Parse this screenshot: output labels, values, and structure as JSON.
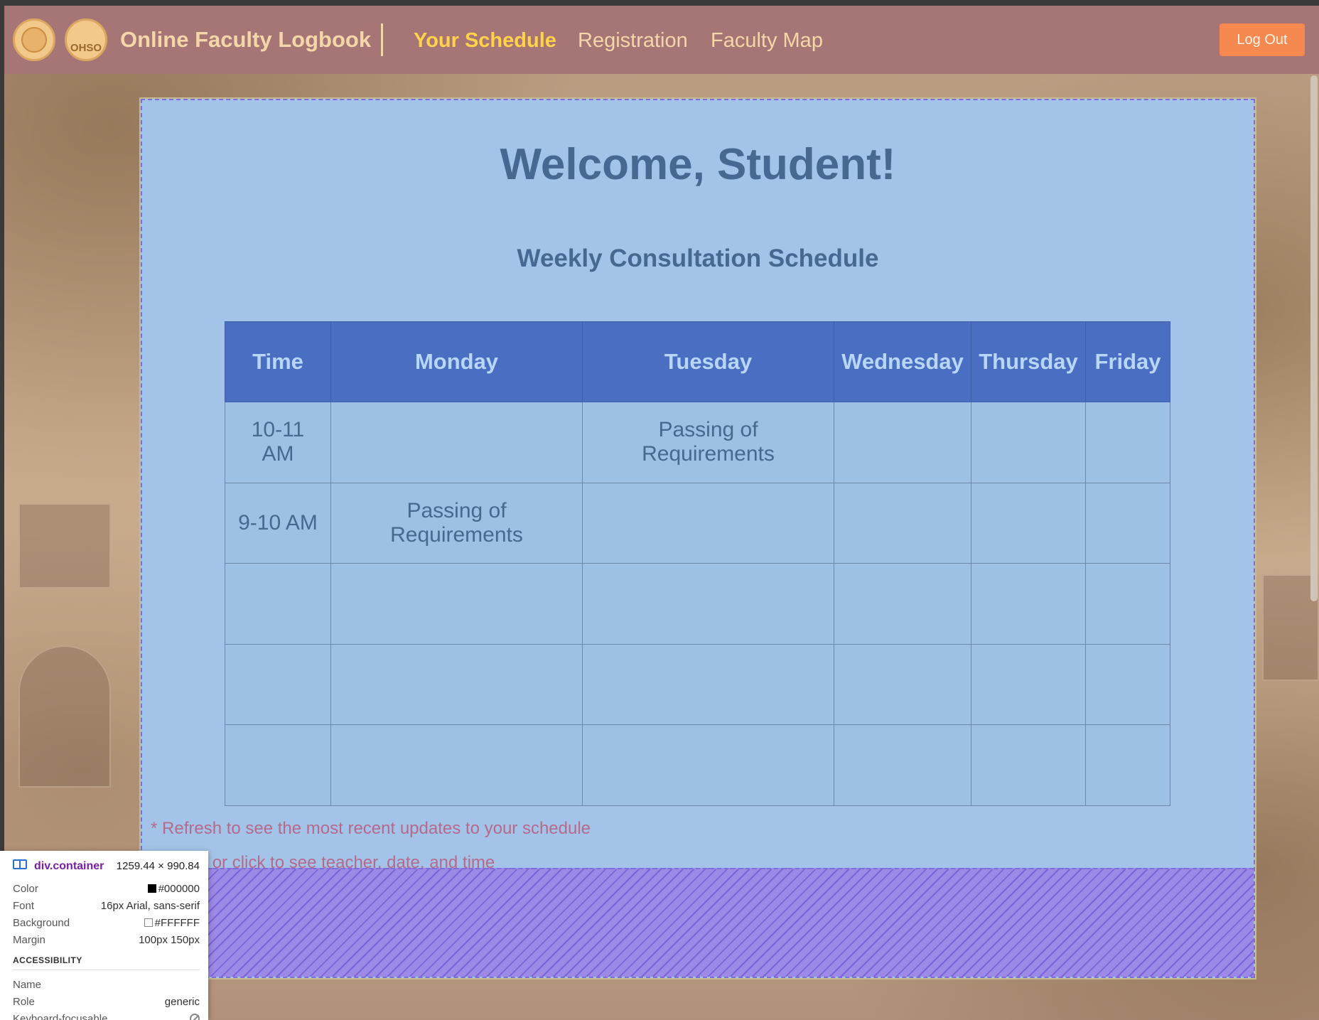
{
  "navbar": {
    "brand": "Online Faculty Logbook",
    "logo2_text": "OHSO",
    "links": [
      "Your Schedule",
      "Registration",
      "Faculty Map"
    ],
    "logout": "Log Out"
  },
  "main": {
    "welcome": "Welcome, Student!",
    "subtitle": "Weekly Consultation Schedule",
    "table": {
      "headers": [
        "Time",
        "Monday",
        "Tuesday",
        "Wednesday",
        "Thursday",
        "Friday"
      ],
      "rows": [
        [
          "10-11 AM",
          "",
          "Passing of Requirements",
          "",
          "",
          ""
        ],
        [
          "9-10 AM",
          "Passing of Requirements",
          "",
          "",
          "",
          ""
        ],
        [
          "",
          "",
          "",
          "",
          "",
          ""
        ],
        [
          "",
          "",
          "",
          "",
          "",
          ""
        ],
        [
          "",
          "",
          "",
          "",
          "",
          ""
        ]
      ]
    },
    "notes": [
      "* Refresh to see the most recent updates to your schedule",
      "* Hover or click to see teacher, date, and time"
    ]
  },
  "devtools_tooltip": {
    "element": "div.container",
    "size": "1259.44 × 990.84",
    "rows": [
      {
        "label": "Color",
        "value": "#000000",
        "swatch": "#000000"
      },
      {
        "label": "Font",
        "value": "16px Arial, sans-serif"
      },
      {
        "label": "Background",
        "value": "#FFFFFF",
        "swatch": "#FFFFFF"
      },
      {
        "label": "Margin",
        "value": "100px 150px"
      }
    ],
    "section": "ACCESSIBILITY",
    "a11y": [
      {
        "label": "Name",
        "value": ""
      },
      {
        "label": "Role",
        "value": "generic"
      },
      {
        "label": "Keyboard-focusable",
        "value": ""
      }
    ]
  },
  "colors": {
    "navbar": "#a67676",
    "brand_text": "#f4d6a8",
    "active_link": "#ffd24a",
    "logout_bg": "#f5894f",
    "container_bg": "#a3c4e8",
    "table_header_bg": "#4a6fc2",
    "heading_text": "#476890",
    "note_text": "#b56a8c"
  }
}
